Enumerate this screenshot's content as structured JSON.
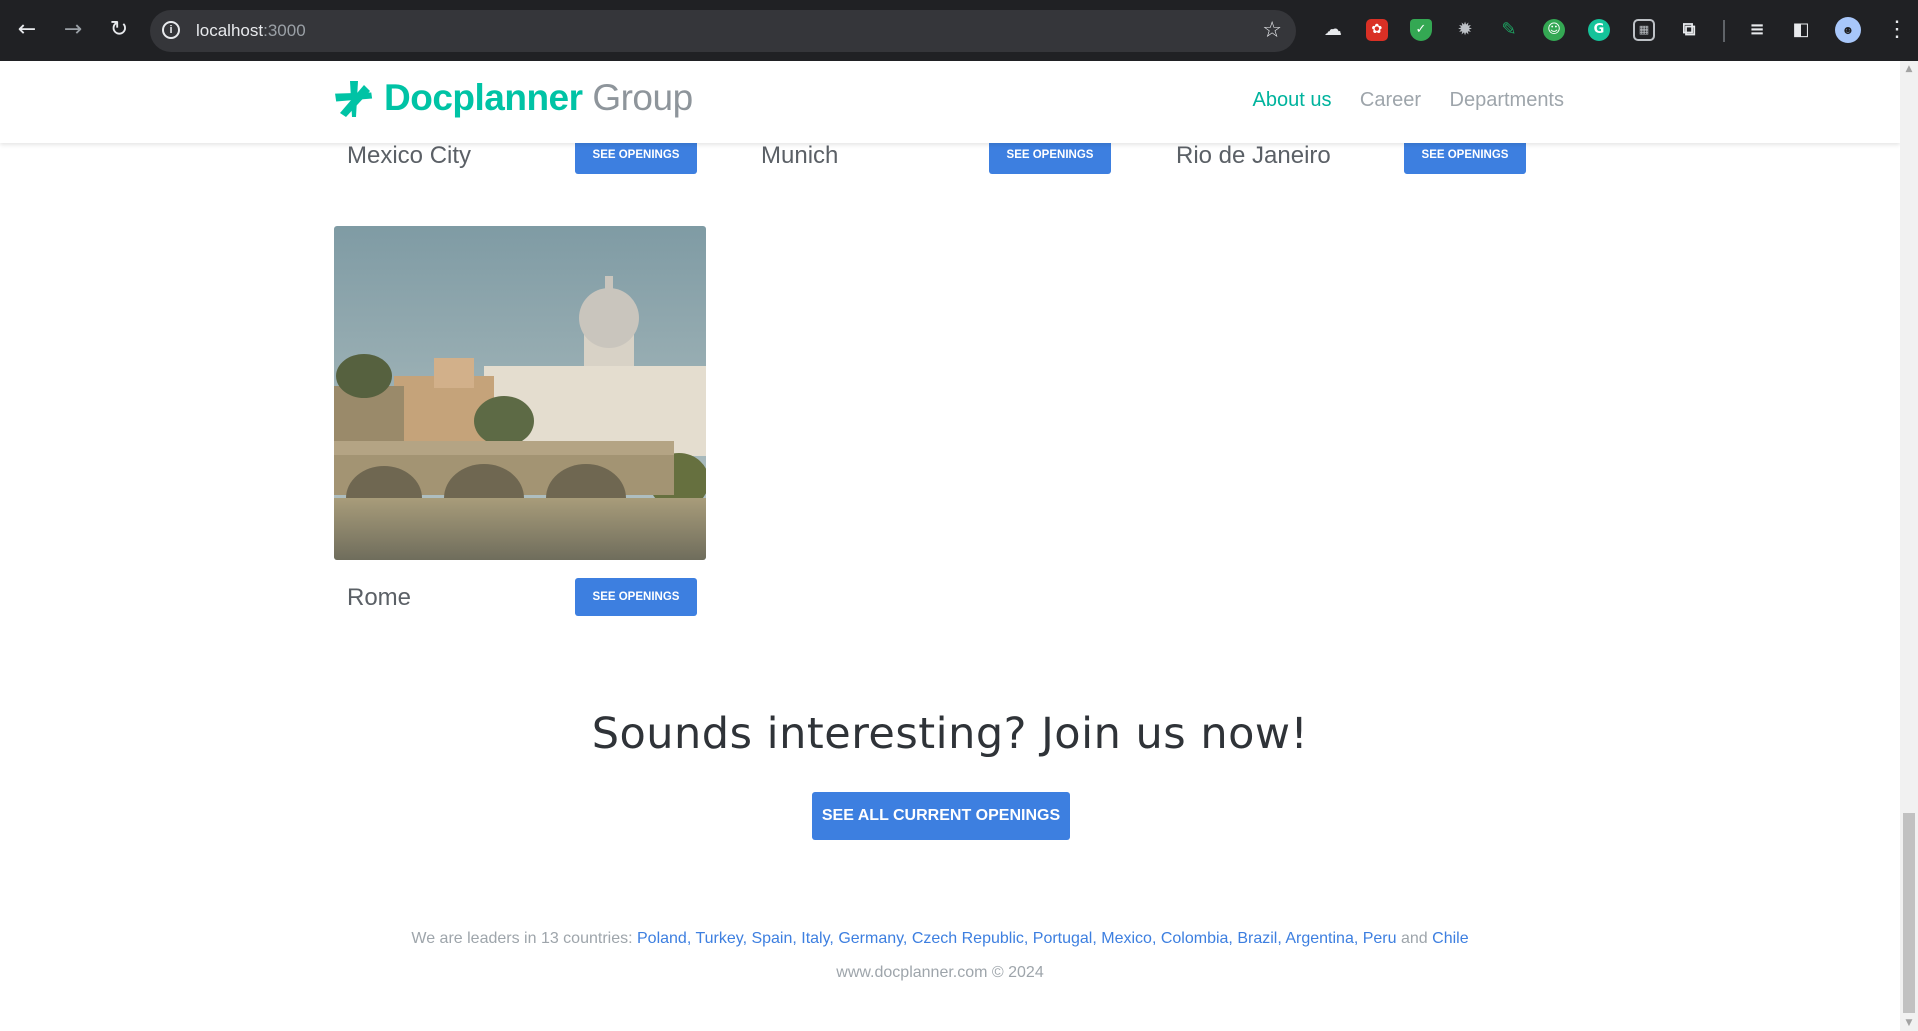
{
  "browser": {
    "url_host": "localhost",
    "url_port": ":3000"
  },
  "header": {
    "brand_primary": "Docplanner",
    "brand_secondary": "Group",
    "nav": [
      {
        "label": "About us",
        "active": true
      },
      {
        "label": "Career",
        "active": false
      },
      {
        "label": "Departments",
        "active": false
      }
    ]
  },
  "cities": [
    {
      "name": "Mexico City",
      "button": "SEE OPENINGS"
    },
    {
      "name": "Munich",
      "button": "SEE OPENINGS"
    },
    {
      "name": "Rio de Janeiro",
      "button": "SEE OPENINGS"
    },
    {
      "name": "Rome",
      "button": "SEE OPENINGS"
    }
  ],
  "cta": {
    "title": "Sounds interesting? Join us now!",
    "button": "SEE ALL CURRENT OPENINGS"
  },
  "footer": {
    "intro": "We are leaders in 13 countries: ",
    "countries": [
      "Poland",
      "Turkey",
      "Spain",
      "Italy",
      "Germany",
      "Czech Republic",
      "Portugal",
      "Mexico",
      "Colombia",
      "Brazil",
      "Argentina",
      "Peru"
    ],
    "and_word": "and",
    "last_country": "Chile",
    "separator": ", ",
    "copyright": "www.docplanner.com © 2024"
  },
  "colors": {
    "brand": "#00c3a5",
    "button": "#3d7fe0",
    "chrome_bg": "#202124"
  }
}
